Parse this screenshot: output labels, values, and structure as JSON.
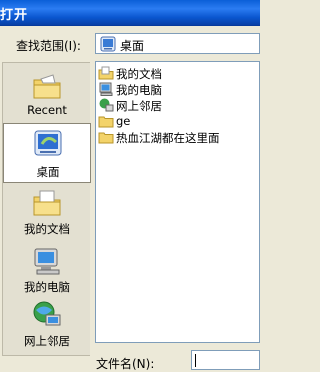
{
  "window": {
    "title": "打开"
  },
  "look_in": {
    "label": "查找范围(I):",
    "value": "桌面",
    "icon": "desktop-icon"
  },
  "places": [
    {
      "label": "Recent",
      "icon": "recent-folder-icon",
      "selected": false
    },
    {
      "label": "桌面",
      "icon": "desktop-icon",
      "selected": true
    },
    {
      "label": "我的文档",
      "icon": "my-documents-icon",
      "selected": false
    },
    {
      "label": "我的电脑",
      "icon": "my-computer-icon",
      "selected": false
    },
    {
      "label": "网上邻居",
      "icon": "network-places-icon",
      "selected": false
    }
  ],
  "files": [
    {
      "name": "我的文档",
      "icon": "my-documents-icon"
    },
    {
      "name": "我的电脑",
      "icon": "my-computer-icon"
    },
    {
      "name": "网上邻居",
      "icon": "network-places-icon"
    },
    {
      "name": "ge",
      "icon": "folder-icon"
    },
    {
      "name": "热血江湖都在这里面",
      "icon": "folder-icon"
    }
  ],
  "filename": {
    "label": "文件名(N):",
    "value": ""
  }
}
